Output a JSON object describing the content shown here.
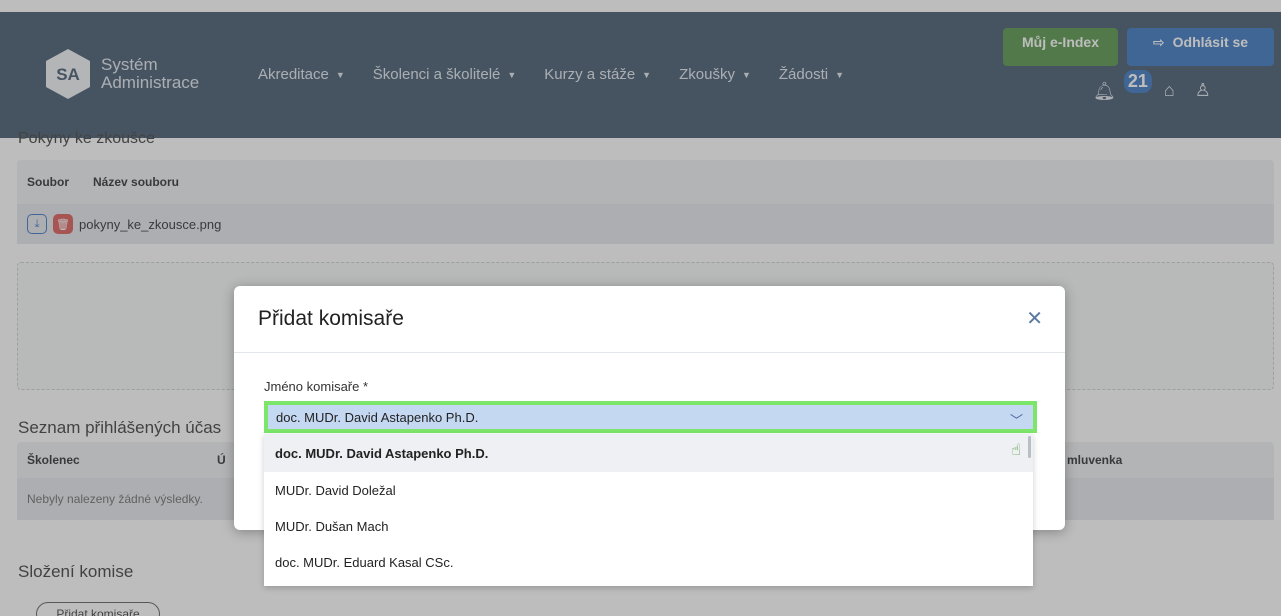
{
  "header": {
    "logo_text": "SA",
    "brand_line1": "Systém",
    "brand_line2": "Administrace",
    "nav": [
      {
        "label": "Akreditace"
      },
      {
        "label": "Školenci a školitelé"
      },
      {
        "label": "Kurzy a stáže"
      },
      {
        "label": "Zkoušky"
      },
      {
        "label": "Žádosti"
      }
    ],
    "eindex_label": "Můj e-Index",
    "logout_label": "Odhlásit se",
    "notification_count": "21",
    "colors": {
      "header_bg": "#3a5068",
      "eindex": "#4b8e3e",
      "logout": "#2f6fbf"
    }
  },
  "page": {
    "cut_title": "Pokyny ke zkoušce",
    "files_table": {
      "headers": [
        "Soubor",
        "Název souboru"
      ],
      "rows": [
        {
          "filename": "pokyny_ke_zkousce.png"
        }
      ]
    },
    "participants_title": "Seznam přihlášených účas",
    "participants_table": {
      "headers": [
        "Školenec",
        "Ú",
        "mluvenka"
      ],
      "empty_text": "Nebyly nalezeny žádné výsledky."
    },
    "committee_title": "Složení komise",
    "add_committee_button": "Přidat komisaře"
  },
  "modal": {
    "title": "Přidat komisaře",
    "field_label": "Jméno komisaře *",
    "selected_value": "doc. MUDr. David Astapenko Ph.D.",
    "options": [
      "doc. MUDr. David Astapenko Ph.D.",
      "MUDr. David Doležal",
      "MUDr. Dušan Mach",
      "doc. MUDr. Eduard Kasal CSc."
    ]
  }
}
